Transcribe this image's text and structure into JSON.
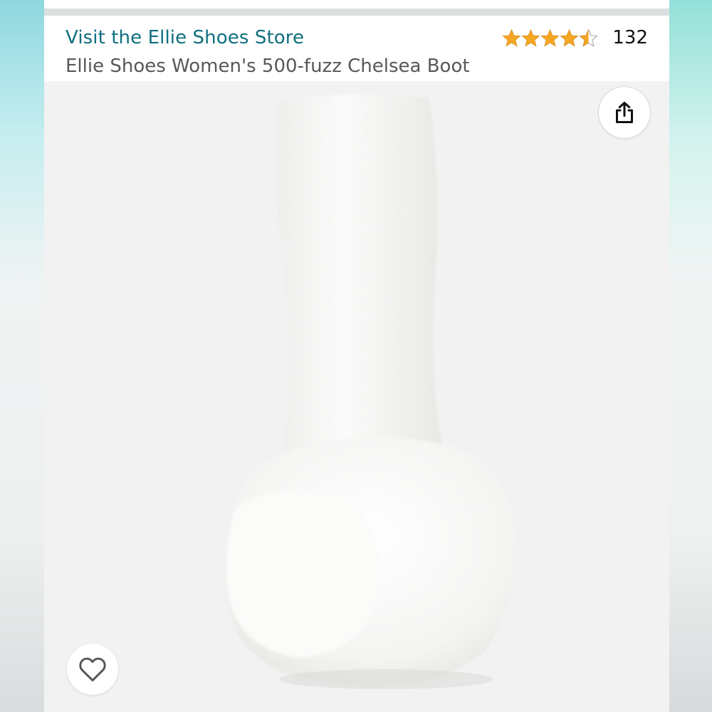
{
  "header": {
    "store_link": "Visit the Ellie Shoes Store",
    "product_title": "Ellie Shoes Women's 500-fuzz Chelsea Boot"
  },
  "rating": {
    "stars": 4.5,
    "count": "132"
  },
  "colors": {
    "store_link": "#0f6f7f",
    "star": "#f5a623",
    "title": "#565959"
  },
  "icons": {
    "share": "share-icon",
    "favorite": "heart-icon"
  },
  "product_image": {
    "subject": "white fluffy platform boot"
  }
}
